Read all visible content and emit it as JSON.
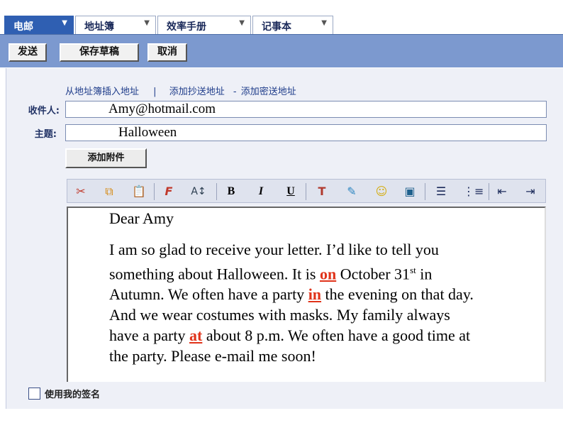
{
  "tabs": [
    {
      "label": "电邮"
    },
    {
      "label": "地址簿"
    },
    {
      "label": "效率手册"
    },
    {
      "label": "记事本"
    }
  ],
  "toolbar": {
    "send": "发送",
    "save_draft": "保存草稿",
    "cancel": "取消"
  },
  "links": {
    "insert_address": "从地址簿插入地址",
    "sep1": "|",
    "add_cc": "添加抄送地址",
    "sep2": "-",
    "add_bcc": "添加密送地址"
  },
  "to_label": "收件人:",
  "to_value": "Amy@hotmail.com",
  "subject_label": "主题:",
  "subject_value": "Halloween",
  "attach_label": "添加附件",
  "format_icons": [
    "cut-icon",
    "copy-icon",
    "paste-icon",
    "font-icon",
    "font-size-icon",
    "bold-icon",
    "italic-icon",
    "underline-icon",
    "text-color-icon",
    "highlight-icon",
    "emoticon-icon",
    "insert-image-icon",
    "align-icon",
    "list-icon",
    "outdent-icon",
    "indent-icon"
  ],
  "colors": {
    "accent": "#2f5fb2",
    "toolbar": "#7c99cf",
    "answer": "#e0331a"
  },
  "letter": {
    "greeting": "Dear Amy",
    "p1": "I am so glad to receive your letter. I’d like to tell you something about Halloween. It is",
    "a1": "on",
    "p2": "October 31",
    "sup": "st",
    "p3": "in Autumn. We often have a party",
    "a2": "in",
    "p4": "the evening on that day. And we wear costumes with masks. My family always have a party",
    "a3": "at",
    "p5": "about 8 p.m. We often have a good time at the party. Please e-mail me soon!"
  },
  "signature_label": "使用我的签名"
}
